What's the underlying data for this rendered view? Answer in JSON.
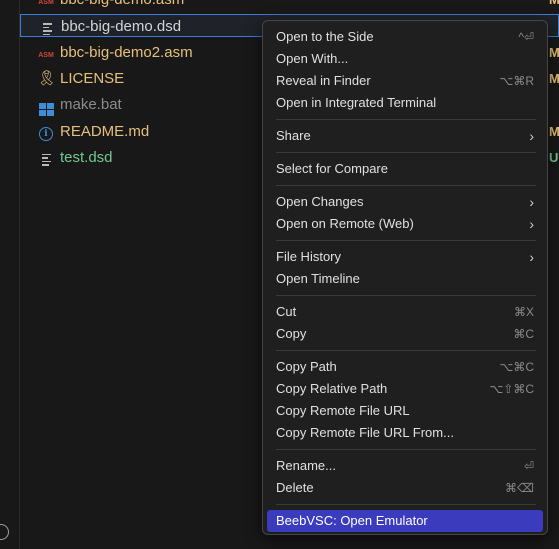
{
  "explorer": {
    "files": [
      {
        "name": "bbc-big-demo.asm",
        "color": "#e5c07b",
        "badge": "M",
        "icon": "asm-icon",
        "partial": true
      },
      {
        "name": "bbc-big-demo.dsd",
        "color": "#d4d4d4",
        "badge": "",
        "icon": "text-file-icon",
        "selected": true
      },
      {
        "name": "bbc-big-demo2.asm",
        "color": "#e5c07b",
        "badge": "M",
        "icon": "asm-icon"
      },
      {
        "name": "LICENSE",
        "color": "#e5c07b",
        "badge": "M",
        "icon": "license-icon"
      },
      {
        "name": "make.bat",
        "color": "#8b8b8b",
        "badge": "",
        "icon": "windows-icon"
      },
      {
        "name": "README.md",
        "color": "#e5c07b",
        "badge": "M",
        "icon": "info-icon"
      },
      {
        "name": "test.dsd",
        "color": "#73c991",
        "badge": "U",
        "icon": "text-file-icon"
      }
    ],
    "icon_glyphs": {
      "asm": "ASM",
      "license": "🎗",
      "info": "i"
    }
  },
  "context_menu": {
    "groups": [
      [
        {
          "label": "Open to the Side",
          "shortcut": "^⏎"
        },
        {
          "label": "Open With...",
          "shortcut": ""
        },
        {
          "label": "Reveal in Finder",
          "shortcut": "⌥⌘R"
        },
        {
          "label": "Open in Integrated Terminal",
          "shortcut": ""
        }
      ],
      [
        {
          "label": "Share",
          "shortcut": "",
          "submenu": true
        }
      ],
      [
        {
          "label": "Select for Compare",
          "shortcut": ""
        }
      ],
      [
        {
          "label": "Open Changes",
          "shortcut": "",
          "submenu": true
        },
        {
          "label": "Open on Remote (Web)",
          "shortcut": "",
          "submenu": true
        }
      ],
      [
        {
          "label": "File History",
          "shortcut": "",
          "submenu": true
        },
        {
          "label": "Open Timeline",
          "shortcut": ""
        }
      ],
      [
        {
          "label": "Cut",
          "shortcut": "⌘X"
        },
        {
          "label": "Copy",
          "shortcut": "⌘C"
        }
      ],
      [
        {
          "label": "Copy Path",
          "shortcut": "⌥⌘C"
        },
        {
          "label": "Copy Relative Path",
          "shortcut": "⌥⇧⌘C"
        },
        {
          "label": "Copy Remote File URL",
          "shortcut": ""
        },
        {
          "label": "Copy Remote File URL From...",
          "shortcut": ""
        }
      ],
      [
        {
          "label": "Rename...",
          "shortcut": "⏎"
        },
        {
          "label": "Delete",
          "shortcut": "⌘⌫"
        }
      ],
      [
        {
          "label": "BeebVSC: Open Emulator",
          "shortcut": "",
          "highlighted": true
        }
      ]
    ],
    "submenu_glyph": "›"
  },
  "colors": {
    "highlight": "#3b3bbd",
    "selection_border": "#3b7dd8",
    "background": "#181818"
  }
}
